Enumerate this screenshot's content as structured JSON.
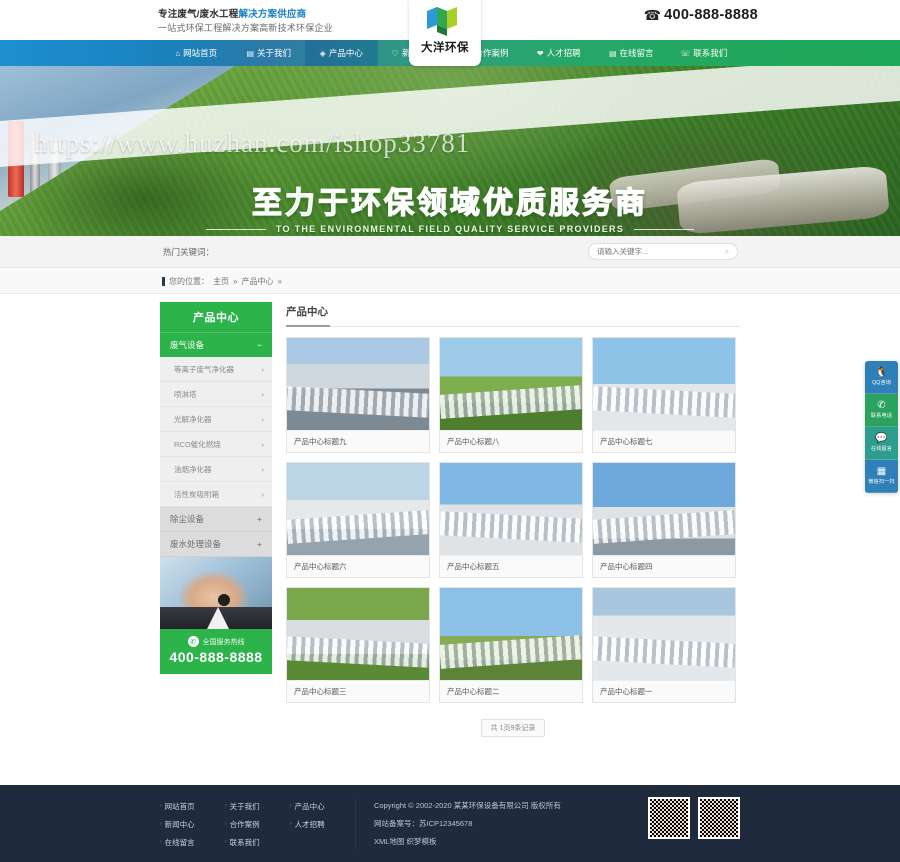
{
  "header": {
    "slogan_line1_a": "专注废气/废水工程",
    "slogan_line1_b": "解决方案供应商",
    "slogan_line2": "一站式环保工程解决方案高新技术环保企业",
    "phone_icon": "telephone-icon",
    "phone": "400-888-8888",
    "logo_name": "大洋环保"
  },
  "nav": {
    "items": [
      {
        "label": "网站首页",
        "icon": "home-icon",
        "active": false
      },
      {
        "label": "关于我们",
        "icon": "info-icon",
        "active": false
      },
      {
        "label": "产品中心",
        "icon": "box-icon",
        "active": true
      },
      {
        "label": "新闻中心",
        "icon": "news-icon",
        "active": false
      },
      {
        "label": "合作案例",
        "icon": "case-icon",
        "active": false
      },
      {
        "label": "人才招聘",
        "icon": "people-icon",
        "active": false
      },
      {
        "label": "在线留言",
        "icon": "message-icon",
        "active": false
      },
      {
        "label": "联系我们",
        "icon": "contact-icon",
        "active": false
      }
    ]
  },
  "banner": {
    "watermark": "https://www.huzhan.com/ishop33781",
    "title": "至力于环保领域优质服务商",
    "subtitle": "TO THE ENVIRONMENTAL FIELD QUALITY SERVICE PROVIDERS"
  },
  "search": {
    "keywords_label": "热门关键词：",
    "placeholder": "请输入关键字...",
    "value": "",
    "button_icon": "search-icon"
  },
  "breadcrumb": {
    "label": "您的位置：",
    "items": [
      "主页",
      "产品中心"
    ],
    "separator": "»"
  },
  "sidebar": {
    "title": "产品中心",
    "active_category": {
      "label": "废气设备",
      "toggle": "−"
    },
    "sub_items": [
      {
        "label": "等离子废气净化器",
        "arrow": "›"
      },
      {
        "label": "喷淋塔",
        "arrow": "›"
      },
      {
        "label": "光解净化器",
        "arrow": "›"
      },
      {
        "label": "RCO催化燃烧",
        "arrow": "›"
      },
      {
        "label": "油烟净化器",
        "arrow": "›"
      },
      {
        "label": "活性炭吸附箱",
        "arrow": "›"
      }
    ],
    "categories": [
      {
        "label": "除尘设备",
        "toggle": "+"
      },
      {
        "label": "废水处理设备",
        "toggle": "+"
      }
    ],
    "service_image": "customer-service-agent-photo",
    "hotline_icon": "phone-circle-icon",
    "hotline_label": "全国服务热线",
    "hotline_number": "400-888-8888"
  },
  "content": {
    "title": "产品中心",
    "products": [
      {
        "title": "产品中心标题九",
        "image": "pipeline-rows-photo"
      },
      {
        "title": "产品中心标题八",
        "image": "pipeline-green-hill-photo"
      },
      {
        "title": "产品中心标题七",
        "image": "white-pipes-sky-photo"
      },
      {
        "title": "产品中心标题六",
        "image": "curved-pipeline-photo"
      },
      {
        "title": "产品中心标题五",
        "image": "industrial-silos-photo"
      },
      {
        "title": "产品中心标题四",
        "image": "pipeline-bridge-photo"
      },
      {
        "title": "产品中心标题三",
        "image": "pipeline-forest-photo"
      },
      {
        "title": "产品中心标题二",
        "image": "pipeline-field-photo"
      },
      {
        "title": "产品中心标题一",
        "image": "vertical-pipes-photo"
      }
    ],
    "pagination": "共 1页9条记录"
  },
  "tools": [
    {
      "label": "QQ咨询",
      "icon": "qq-penguin-icon",
      "color": "#2f7fb8"
    },
    {
      "label": "联系电话",
      "icon": "phone-icon",
      "color": "#2ba35e"
    },
    {
      "label": "在线留言",
      "icon": "chat-bubble-icon",
      "color": "#2e9c8e"
    },
    {
      "label": "微信扫一扫",
      "icon": "qrcode-icon",
      "color": "#2f7fb8"
    }
  ],
  "footer": {
    "links": [
      {
        "label": "网站首页",
        "arrow": "›"
      },
      {
        "label": "关于我们",
        "arrow": "›"
      },
      {
        "label": "产品中心",
        "arrow": "›"
      },
      {
        "label": "新闻中心",
        "arrow": "›"
      },
      {
        "label": "合作案例",
        "arrow": "›"
      },
      {
        "label": "人才招聘",
        "arrow": "›"
      },
      {
        "label": "在线留言",
        "arrow": "›"
      },
      {
        "label": "联系我们",
        "arrow": "›"
      }
    ],
    "copyright": "Copyright © 2002-2020 某某环保设备有限公司 版权所有",
    "icp": "网站备案号：苏ICP12345678",
    "extra": "XML地图 织梦模板",
    "qr_codes": [
      "wechat-qrcode",
      "mobile-site-qrcode"
    ]
  },
  "colors": {
    "green": "#2cb34a",
    "blue": "#1e8fcf",
    "footer": "#1f2a3c",
    "title_green": "#3ddb3d"
  }
}
